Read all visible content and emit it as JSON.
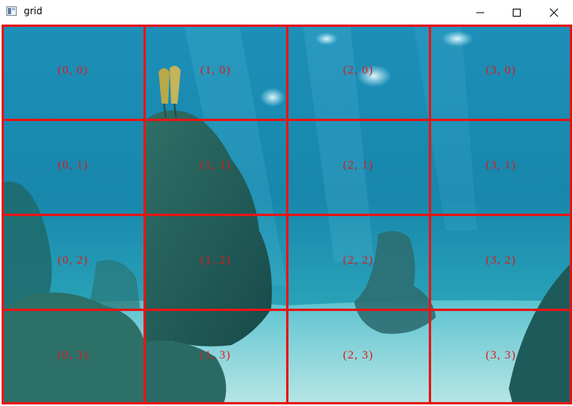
{
  "window": {
    "title": "grid",
    "icon": "app-window-icon",
    "controls": {
      "minimize": "minimize-icon",
      "maximize": "maximize-icon",
      "close": "close-icon"
    }
  },
  "grid": {
    "color": "#e51616",
    "label_color": "#e01818",
    "columns": 4,
    "rows": 4,
    "cells": [
      [
        "(0, 0)",
        "(1, 0)",
        "(2, 0)",
        "(3, 0)"
      ],
      [
        "(0, 1)",
        "(1, 1)",
        "(2, 1)",
        "(3, 1)"
      ],
      [
        "(0, 2)",
        "(1, 2)",
        "(2, 2)",
        "(3, 2)"
      ],
      [
        "(0, 3)",
        "(1, 3)",
        "(2, 3)",
        "(3, 3)"
      ]
    ]
  },
  "scene": {
    "description_colors": {
      "water": "#1a8fb5",
      "rock": "#1f5a56",
      "sand": "#9fd8dc"
    }
  }
}
